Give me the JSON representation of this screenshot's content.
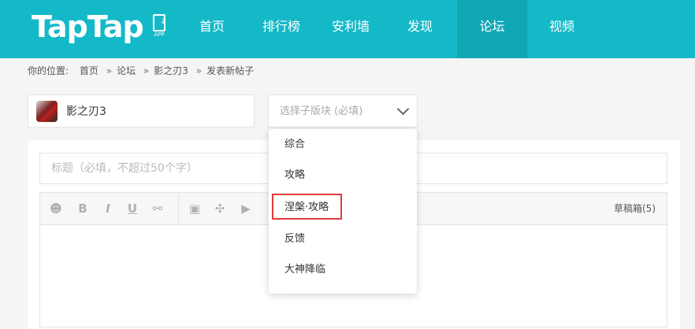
{
  "header": {
    "logo": "TapTap",
    "app_label": "APP",
    "nav": [
      {
        "label": "首页"
      },
      {
        "label": "排行榜"
      },
      {
        "label": "安利墙"
      },
      {
        "label": "发现"
      },
      {
        "label": "论坛",
        "active": true
      },
      {
        "label": "视频"
      }
    ]
  },
  "breadcrumb": {
    "prefix": "你的位置:",
    "items": [
      "首页",
      "论坛",
      "影之刃3",
      "发表新帖子"
    ],
    "separator": "»"
  },
  "game": {
    "name": "影之刃3"
  },
  "subforum_select": {
    "placeholder": "选择子版块 (必填)",
    "options": [
      "综合",
      "攻略",
      "涅槃·攻略",
      "反馈",
      "大神降临"
    ],
    "highlighted": "涅槃·攻略"
  },
  "post": {
    "title_placeholder": "标题（必填，不超过50个字）",
    "drafts_label": "草稿箱(5)"
  },
  "toolbar": {
    "bold": "B",
    "italic": "I",
    "underline": "U"
  },
  "colors": {
    "header_bg": "#14b9c8",
    "nav_active_bg": "#10a7b5",
    "highlight_border": "#e03a3a"
  }
}
